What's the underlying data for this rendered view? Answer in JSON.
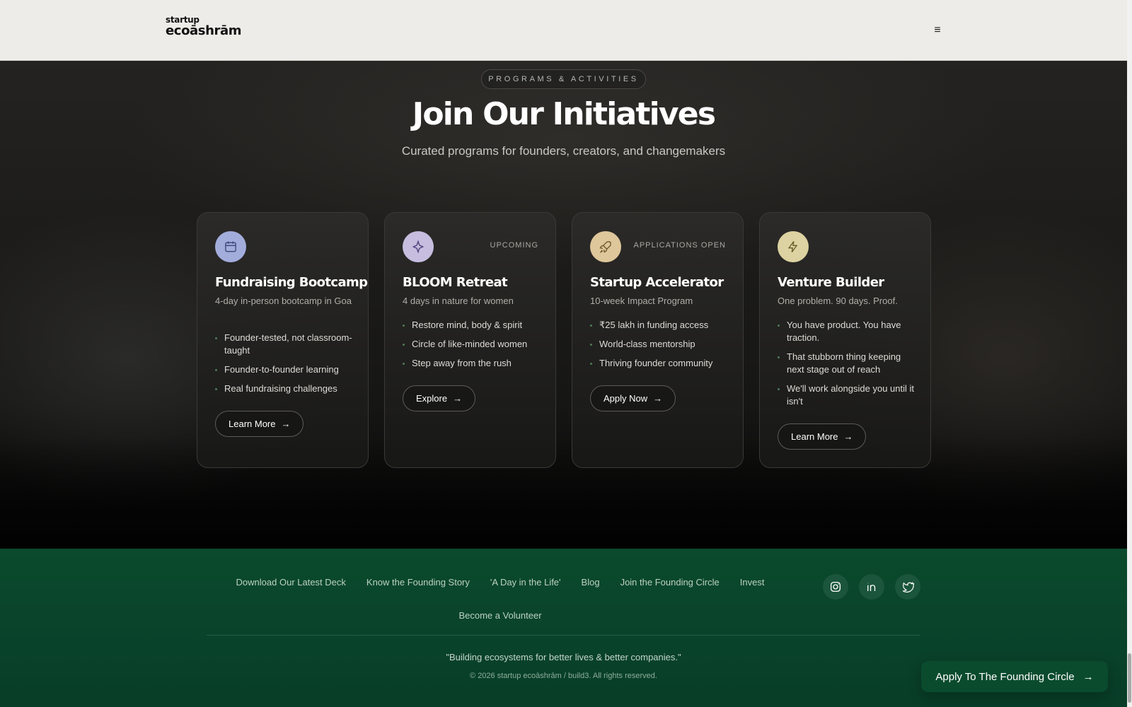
{
  "header": {
    "logo_top": "startup",
    "logo_bottom": "ecoāshrām",
    "menu_icon": "≡"
  },
  "programs": {
    "eyebrow": "PROGRAMS & ACTIVITIES",
    "title": "Join Our Initiatives",
    "subtitle": "Curated programs for founders, creators, and changemakers",
    "cards": [
      {
        "icon": "calendar-icon",
        "icon_bg": "#a3addc",
        "badge": "",
        "title": "Fundraising Bootcamp",
        "description": "4-day in-person bootcamp in Goa",
        "bullets": [
          "Founder-tested, not classroom-taught",
          "Founder-to-founder learning",
          "Real fundraising challenges"
        ],
        "cta": "Learn More"
      },
      {
        "icon": "sparkle-icon",
        "icon_bg": "#c6bddf",
        "badge": "UPCOMING",
        "title": "BLOOM Retreat",
        "description": "4 days in nature for women",
        "bullets": [
          "Restore mind, body & spirit",
          "Circle of like-minded women",
          "Step away from the rush"
        ],
        "cta": "Explore"
      },
      {
        "icon": "rocket-icon",
        "icon_bg": "#dec79a",
        "badge": "APPLICATIONS OPEN",
        "title": "Startup Accelerator",
        "description": "10-week Impact Program",
        "bullets": [
          "₹25 lakh in funding access",
          "World-class mentorship",
          "Thriving founder community"
        ],
        "cta": "Apply Now"
      },
      {
        "icon": "lightning-icon",
        "icon_bg": "#ddd2a1",
        "badge": "",
        "title": "Venture Builder",
        "description": "One problem. 90 days. Proof.",
        "bullets": [
          "You have product. You have traction.",
          "That stubborn thing keeping next stage out of reach",
          "We'll work alongside you until it isn't"
        ],
        "cta": "Learn More"
      }
    ]
  },
  "footer": {
    "links": [
      "Download Our Latest Deck",
      "Know the Founding Story",
      "'A Day in the Life'",
      "Blog",
      "Join the Founding Circle",
      "Invest",
      "Become a Volunteer"
    ],
    "socials": [
      "instagram-icon",
      "linkedin-icon",
      "twitter-icon"
    ],
    "quote": "\"Building ecosystems for better lives & better companies.\"",
    "copyright": "© 2026 startup ecoāshrām / build3. All rights reserved.",
    "floating_cta": "Apply To The Founding Circle"
  },
  "colors": {
    "footer_green": "#0b4a2d",
    "accent_dot": "#4f7a55"
  }
}
